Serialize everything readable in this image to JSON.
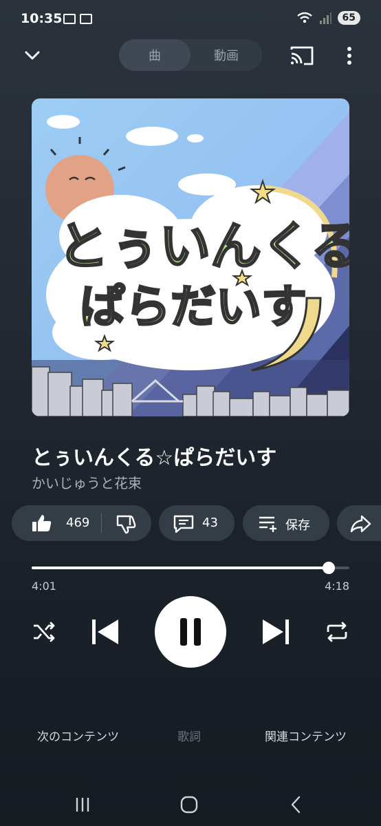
{
  "status_bar": {
    "time": "10:35",
    "battery": "65",
    "notification_icons": [
      "message-icon",
      "mail-icon"
    ]
  },
  "top_bar": {
    "tab_song": "曲",
    "tab_video": "動画",
    "selected_tab": "曲"
  },
  "artwork": {
    "logo_line1": "とぅいんくる",
    "logo_line2": "ぱらだいす"
  },
  "track": {
    "title": "とぅいんくる☆ぱらだいす",
    "artist": "かいじゅうと花束"
  },
  "actions": {
    "like_count": "469",
    "comment_count": "43",
    "save_label": "保存"
  },
  "progress": {
    "elapsed": "4:01",
    "total": "4:18",
    "fraction": 0.934
  },
  "bottom_tabs": {
    "next": "次のコンテンツ",
    "lyrics": "歌詞",
    "related": "関連コンテンツ"
  },
  "colors": {
    "background": "#232a33",
    "pill": "#343c46",
    "accent": "#ffffff",
    "muted_text": "#aab1ba"
  }
}
